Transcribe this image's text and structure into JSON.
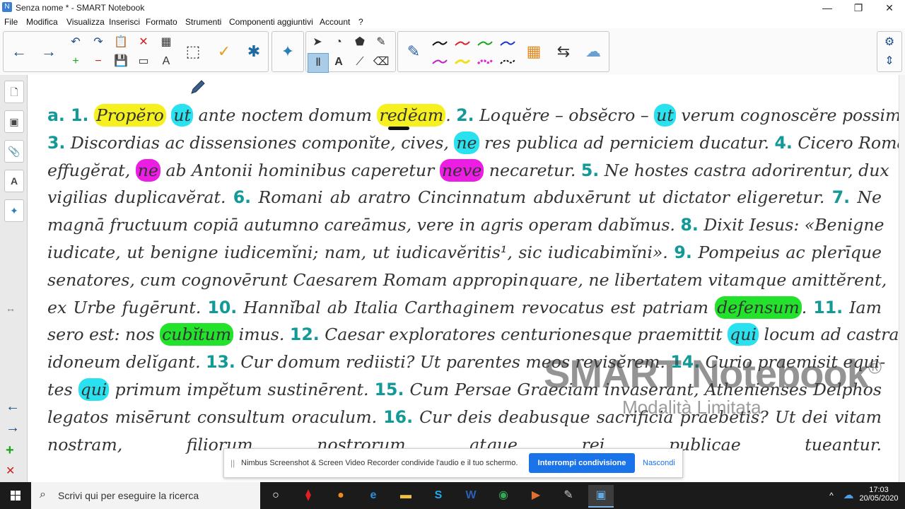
{
  "window": {
    "title": "Senza nome * - SMART Notebook",
    "minimize": "—",
    "maximize": "❐",
    "close": "✕"
  },
  "menu": [
    "File",
    "Modifica",
    "Visualizza",
    "Inserisci",
    "Formato",
    "Strumenti",
    "Componenti aggiuntivi",
    "Account",
    "?"
  ],
  "toolbar": {
    "back_icon": "←",
    "forward_icon": "→",
    "undo_icon": "↶",
    "redo_icon": "↷",
    "paste_icon": "📋",
    "delete_icon": "✕",
    "table_icon": "▦",
    "add_page_icon": "+",
    "remove_page_icon": "−",
    "save_icon": "💾",
    "screen_shade_icon": "▭",
    "text_icon": "A",
    "capture_icon": "⬚",
    "check_icon": "✓",
    "lab_icon": "✱",
    "puzzle_icon": "✦",
    "select_icon": "➤",
    "shapes_icon": "◔",
    "fill_icon": "⬟",
    "magic_pen_icon": "✎",
    "lines_icon": "⟋",
    "text_tool_icon": "A",
    "eraser_icon": "⌫",
    "pens_icon": "Ⅱ",
    "pen_icon": "✎",
    "properties_icon": "⇆",
    "color_grid_icon": "▦",
    "cloud_icon": "☁",
    "gear_icon": "⚙",
    "arrows_icon": "⇕"
  },
  "pen_colors": [
    "#111111",
    "#e0202a",
    "#1aa51a",
    "#1a35d0",
    "#c020c8",
    "#f0e020",
    "#e020d8",
    "#111111"
  ],
  "sidebar": {
    "page_icon": "🗋",
    "gallery_icon": "▣",
    "attach_icon": "📎",
    "properties_icon": "A",
    "addons_icon": "✦",
    "resize_icon": "↔",
    "prev_icon": "←",
    "next_icon": "→",
    "add_icon": "+",
    "delete_icon": "✕"
  },
  "text_lines": [
    [
      {
        "t": "a. 1.",
        "n": 1
      },
      {
        "t": " "
      },
      {
        "t": "Propĕro",
        "h": "y"
      },
      {
        "t": " "
      },
      {
        "t": "ut",
        "h": "c"
      },
      {
        "t": " ante noctem domum "
      },
      {
        "t": "redĕam",
        "h": "y"
      },
      {
        "t": ". "
      },
      {
        "t": "2.",
        "n": 1
      },
      {
        "t": " Loquĕre – obsĕcro – "
      },
      {
        "t": "ut",
        "h": "c"
      },
      {
        "t": " verum cognoscĕre possim."
      }
    ],
    [
      {
        "t": "3.",
        "n": 1
      },
      {
        "t": " Discordias ac dissensiones componĭte, cives, "
      },
      {
        "t": "ne",
        "h": "c"
      },
      {
        "t": " res publica ad perniciem ducatur. "
      },
      {
        "t": "4.",
        "n": 1
      },
      {
        "t": " Cicero Romā"
      }
    ],
    [
      {
        "t": "effugĕrat, "
      },
      {
        "t": "ne",
        "h": "m"
      },
      {
        "t": " ab Antonii hominibus caperetur "
      },
      {
        "t": "neve",
        "h": "m"
      },
      {
        "t": " necaretur. "
      },
      {
        "t": "5.",
        "n": 1
      },
      {
        "t": " Ne hostes castra adorirentur, dux"
      }
    ],
    [
      {
        "t": "vigilias duplicavĕrat. "
      },
      {
        "t": "6.",
        "n": 1
      },
      {
        "t": " Romani ab aratro Cincinnatum abduxērunt ut dictator eligeretur. "
      },
      {
        "t": "7.",
        "n": 1
      },
      {
        "t": " Ne"
      }
    ],
    [
      {
        "t": "magnā fructuum copiā autumno careāmus, vere in agris operam dabĭmus. "
      },
      {
        "t": "8.",
        "n": 1
      },
      {
        "t": " Dixit Iesus: «Benigne"
      }
    ],
    [
      {
        "t": "iudicate, ut benigne iudicemĭni; nam, ut iudicavĕritis¹, sic iudicabimĭni». "
      },
      {
        "t": "9.",
        "n": 1
      },
      {
        "t": " Pompeius ac plerīque"
      }
    ],
    [
      {
        "t": "senatores, cum cognovērunt Caesarem Romam appropinquare, ne libertatem vitamque amittĕrent,"
      }
    ],
    [
      {
        "t": "ex Urbe fugērunt. "
      },
      {
        "t": "10.",
        "n": 1
      },
      {
        "t": " Hannĭbal ab Italia Carthaginem revocatus est patriam "
      },
      {
        "t": "defensum",
        "h": "g"
      },
      {
        "t": ". "
      },
      {
        "t": "11.",
        "n": 1
      },
      {
        "t": " Iam"
      }
    ],
    [
      {
        "t": "sero est: nos "
      },
      {
        "t": "cubĭtum",
        "h": "g"
      },
      {
        "t": " imus. "
      },
      {
        "t": "12.",
        "n": 1
      },
      {
        "t": " Caesar exploratores centurionesque praemittit "
      },
      {
        "t": "qui",
        "h": "c"
      },
      {
        "t": " locum ad castra"
      }
    ],
    [
      {
        "t": "idoneum delĭgant. "
      },
      {
        "t": "13.",
        "n": 1
      },
      {
        "t": " Cur domum rediisti? Ut parentes meos revisĕrem. "
      },
      {
        "t": "14.",
        "n": 1
      },
      {
        "t": " Curio praemisit equi-"
      }
    ],
    [
      {
        "t": "tes "
      },
      {
        "t": "qui",
        "h": "c"
      },
      {
        "t": " primum impĕtum sustinērent. "
      },
      {
        "t": "15.",
        "n": 1
      },
      {
        "t": " Cum Persae Graeciam invaserant, Athenienses Delphos"
      }
    ],
    [
      {
        "t": "legatos misērunt consultum oraculum. "
      },
      {
        "t": "16.",
        "n": 1
      },
      {
        "t": " Cur deis deabusque sacrificia praebetis? Ut dei vitam"
      }
    ],
    [
      {
        "t": "nostram, filiorum nostrorum atque rei publicae tueantur."
      }
    ]
  ],
  "watermark": {
    "brand": "SMART Notebook",
    "reg": "®",
    "mode": "Modalità Limitata"
  },
  "sharebar": {
    "grip": "||",
    "message": "Nimbus Screenshot & Screen Video Recorder condivide l'audio e il tuo schermo.",
    "stop": "Interrompi condivisione",
    "hide": "Nascondi"
  },
  "taskbar": {
    "search_placeholder": "Scrivi qui per eseguire la ricerca",
    "time": "17:03",
    "date": "20/05/2020",
    "tray_up": "^",
    "cloud": "☁"
  },
  "colors": {
    "accent_teal": "#139a98",
    "highlight_yellow": "#f6f11e",
    "highlight_cyan": "#29e1ef",
    "highlight_magenta": "#ec1ee4",
    "highlight_green": "#23e22b",
    "share_blue": "#1a73e8"
  }
}
